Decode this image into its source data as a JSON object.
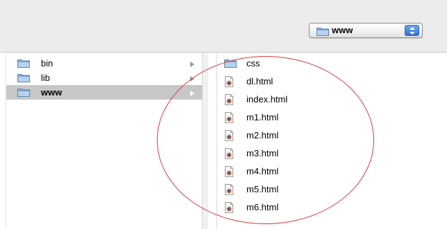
{
  "toolbar": {
    "path_popup": {
      "label": "www",
      "icon": "folder-icon"
    }
  },
  "column1": {
    "items": [
      {
        "label": "bin",
        "icon": "folder-icon",
        "has_children": true,
        "selected": false
      },
      {
        "label": "lib",
        "icon": "folder-icon",
        "has_children": true,
        "selected": false
      },
      {
        "label": "www",
        "icon": "folder-icon",
        "has_children": true,
        "selected": true
      }
    ]
  },
  "column2": {
    "items": [
      {
        "label": "css",
        "icon": "folder-icon"
      },
      {
        "label": "dl.html",
        "icon": "html-file-icon"
      },
      {
        "label": "index.html",
        "icon": "html-file-icon"
      },
      {
        "label": "m1.html",
        "icon": "html-file-icon"
      },
      {
        "label": "m2.html",
        "icon": "html-file-icon"
      },
      {
        "label": "m3.html",
        "icon": "html-file-icon"
      },
      {
        "label": "m4.html",
        "icon": "html-file-icon"
      },
      {
        "label": "m5.html",
        "icon": "html-file-icon"
      },
      {
        "label": "m6.html",
        "icon": "html-file-icon"
      }
    ]
  },
  "annotation": {
    "shape": "ellipse",
    "color": "#d83a3a"
  }
}
